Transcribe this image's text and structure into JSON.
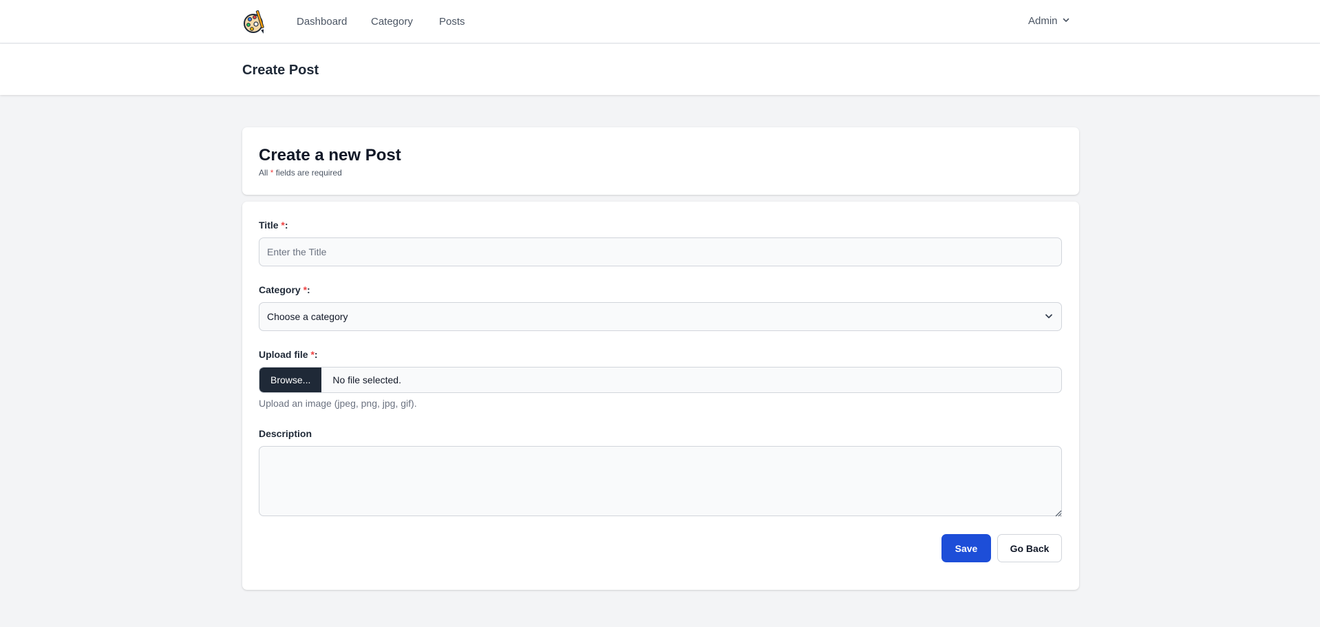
{
  "nav": {
    "links": [
      "Dashboard",
      "Category",
      "Posts"
    ],
    "user": "Admin"
  },
  "header": {
    "title": "Create Post"
  },
  "form": {
    "heading": "Create a new Post",
    "required_note_prefix": "All",
    "required_mark": "*",
    "required_note_suffix": "fields are required",
    "title_label": "Title",
    "title_placeholder": "Enter the Title",
    "category_label": "Category",
    "category_selected": "Choose a category",
    "upload_label": "Upload file",
    "browse_label": "Browse...",
    "file_status": "No file selected.",
    "upload_help": "Upload an image (jpeg, png, jpg, gif).",
    "description_label": "Description",
    "description_value": "",
    "label_suffix": ":",
    "save_label": "Save",
    "back_label": "Go Back"
  },
  "colors": {
    "primary": "#1d4ed8",
    "required": "#ef4444",
    "browse_bg": "#1f2937",
    "page_bg": "#f3f4f6"
  },
  "icons": [
    "palette-logo-icon",
    "chevron-down-icon",
    "resize-grip-icon"
  ]
}
